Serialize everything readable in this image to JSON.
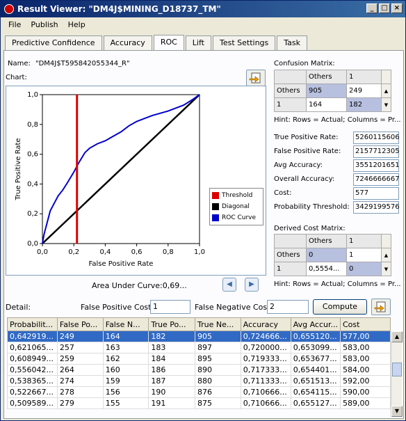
{
  "window": {
    "title": "Result Viewer: \"DM4J$MINING_D18737_TM\""
  },
  "menu": [
    "File",
    "Publish",
    "Help"
  ],
  "tabs": [
    "Predictive Confidence",
    "Accuracy",
    "ROC",
    "Lift",
    "Test Settings",
    "Task"
  ],
  "active_tab": "ROC",
  "name_label": "Name:",
  "name_value": "\"DM4J$T595842055344_R\"",
  "chart_label": "Chart:",
  "area_under_curve": "Area Under Curve:0,69...",
  "chart_data": {
    "type": "line",
    "xlabel": "False Positive Rate",
    "ylabel": "True Positive Rate",
    "xlim": [
      0,
      1
    ],
    "ylim": [
      0,
      1
    ],
    "ticks": [
      "0,0",
      "0,2",
      "0,4",
      "0,6",
      "0,8",
      "1,0"
    ],
    "threshold_x": 0.22,
    "series": [
      {
        "name": "Threshold",
        "color": "#dd0000"
      },
      {
        "name": "Diagonal",
        "color": "#000000",
        "x": [
          0,
          1
        ],
        "y": [
          0,
          1
        ]
      },
      {
        "name": "ROC Curve",
        "color": "#0000cc",
        "x": [
          0,
          0.01,
          0.03,
          0.05,
          0.08,
          0.1,
          0.13,
          0.16,
          0.2,
          0.23,
          0.27,
          0.3,
          0.35,
          0.4,
          0.45,
          0.5,
          0.55,
          0.6,
          0.7,
          0.8,
          0.9,
          0.96,
          1.0
        ],
        "y": [
          0,
          0.06,
          0.14,
          0.22,
          0.28,
          0.32,
          0.36,
          0.41,
          0.48,
          0.54,
          0.61,
          0.64,
          0.67,
          0.69,
          0.72,
          0.75,
          0.79,
          0.82,
          0.86,
          0.89,
          0.93,
          0.97,
          1.0
        ]
      }
    ]
  },
  "confusion": {
    "label": "Confusion Matrix:",
    "header": [
      "Others",
      "1"
    ],
    "rows": [
      {
        "label": "Others",
        "cells": [
          "905",
          "249"
        ]
      },
      {
        "label": "1",
        "cells": [
          "164",
          "182"
        ]
      }
    ],
    "hint": "Hint: Rows = Actual; Columns = Pr..."
  },
  "stats": [
    {
      "label": "True Positive Rate:",
      "value": "5260115606"
    },
    {
      "label": "False Positive Rate:",
      "value": "2157712305"
    },
    {
      "label": "Avg Accuracy:",
      "value": "3551201651"
    },
    {
      "label": "Overall Accuracy:",
      "value": "7246666667"
    },
    {
      "label": "Cost:",
      "value": "577"
    },
    {
      "label": "Probability Threshold:",
      "value": "3429199576"
    }
  ],
  "derived": {
    "label": "Derived Cost Matrix:",
    "header": [
      "Others",
      "1"
    ],
    "rows": [
      {
        "label": "Others",
        "cells": [
          "0",
          "1"
        ]
      },
      {
        "label": "1",
        "cells": [
          "0,5554...",
          "0"
        ]
      }
    ],
    "hint": "Hint: Rows = Actual; Columns = Pr..."
  },
  "detail": {
    "label": "Detail:",
    "fp_label": "False Positive Cost:",
    "fp_value": "1",
    "fn_label": "False Negative Cost:",
    "fn_value": "2",
    "compute_label": "Compute Cost"
  },
  "grid": {
    "columns": [
      "Probabilit...",
      "False Po...",
      "False N...",
      "True Po...",
      "True Ne...",
      "Accuracy",
      "Avg Accur...",
      "Cost"
    ],
    "rows": [
      [
        "0,642919...",
        "249",
        "164",
        "182",
        "905",
        "0,724666...",
        "0,655120...",
        "577,00"
      ],
      [
        "0,621065...",
        "257",
        "163",
        "183",
        "897",
        "0,720000...",
        "0,653099...",
        "583,00"
      ],
      [
        "0,608949...",
        "259",
        "162",
        "184",
        "895",
        "0,719333...",
        "0,653677...",
        "583,00"
      ],
      [
        "0,556042...",
        "264",
        "160",
        "186",
        "890",
        "0,717333...",
        "0,654401...",
        "584,00"
      ],
      [
        "0,538365...",
        "274",
        "159",
        "187",
        "880",
        "0,711333...",
        "0,651513...",
        "592,00"
      ],
      [
        "0,522667...",
        "278",
        "156",
        "190",
        "876",
        "0,710666...",
        "0,654115...",
        "590,00"
      ],
      [
        "0,509589...",
        "279",
        "155",
        "191",
        "875",
        "0,710666...",
        "0,655127...",
        "589,00"
      ]
    ]
  }
}
